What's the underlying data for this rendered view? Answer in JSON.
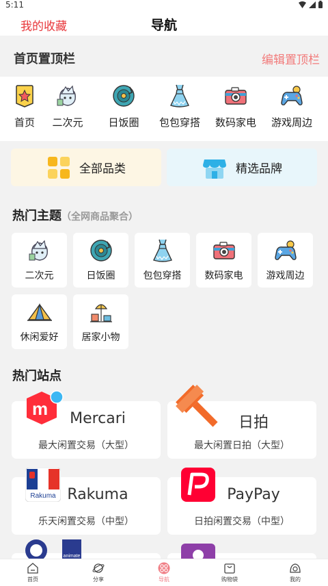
{
  "status": {
    "time": "5:11"
  },
  "topbar": {
    "favorites": "我的收藏",
    "title": "导航"
  },
  "pinned": {
    "heading": "首页置顶栏",
    "edit_label": "编辑置顶栏",
    "items": [
      {
        "label": "首页",
        "icon": "home-star-icon"
      },
      {
        "label": "二次元",
        "icon": "anime-character-icon"
      },
      {
        "label": "日饭圈",
        "icon": "vinyl-record-icon"
      },
      {
        "label": "包包穿搭",
        "icon": "dress-icon"
      },
      {
        "label": "数码家电",
        "icon": "camera-icon"
      },
      {
        "label": "游戏周边",
        "icon": "gamepad-icon"
      }
    ]
  },
  "categories": {
    "all": "全部品类",
    "brands": "精选品牌"
  },
  "hot_topics": {
    "title": "热门主题",
    "subtitle": "（全网商品聚合）",
    "items": [
      {
        "label": "二次元",
        "icon": "anime-character-icon"
      },
      {
        "label": "日饭圈",
        "icon": "vinyl-record-icon"
      },
      {
        "label": "包包穿搭",
        "icon": "dress-icon"
      },
      {
        "label": "数码家电",
        "icon": "camera-icon"
      },
      {
        "label": "游戏周边",
        "icon": "gamepad-icon"
      },
      {
        "label": "休闲爱好",
        "icon": "tent-icon"
      },
      {
        "label": "居家小物",
        "icon": "home-goods-icon"
      }
    ]
  },
  "hot_sites": {
    "title": "热门站点",
    "items": [
      {
        "name": "Mercari",
        "desc": "最大闲置交易（大型）"
      },
      {
        "name": "日拍",
        "desc": "最大闲置日拍（大型）"
      },
      {
        "name": "Rakuma",
        "desc": "乐天闲置交易（中型）"
      },
      {
        "name": "PayPay",
        "desc": "日拍闲置交易（中型）"
      }
    ],
    "logo_texts": {
      "rakuma": "Rakuma",
      "animate": "animate"
    }
  },
  "bottom_nav": {
    "items": [
      {
        "label": "首页"
      },
      {
        "label": "分享"
      },
      {
        "label": "导航"
      },
      {
        "label": "购物袋"
      },
      {
        "label": "我的"
      }
    ]
  },
  "colors": {
    "accent": "#e8373b",
    "edit": "#f27b7b",
    "nav_active": "#f07f86",
    "mercari": "#ff2d3a",
    "auction": "#f26b2a",
    "paypay": "#ff0033"
  }
}
